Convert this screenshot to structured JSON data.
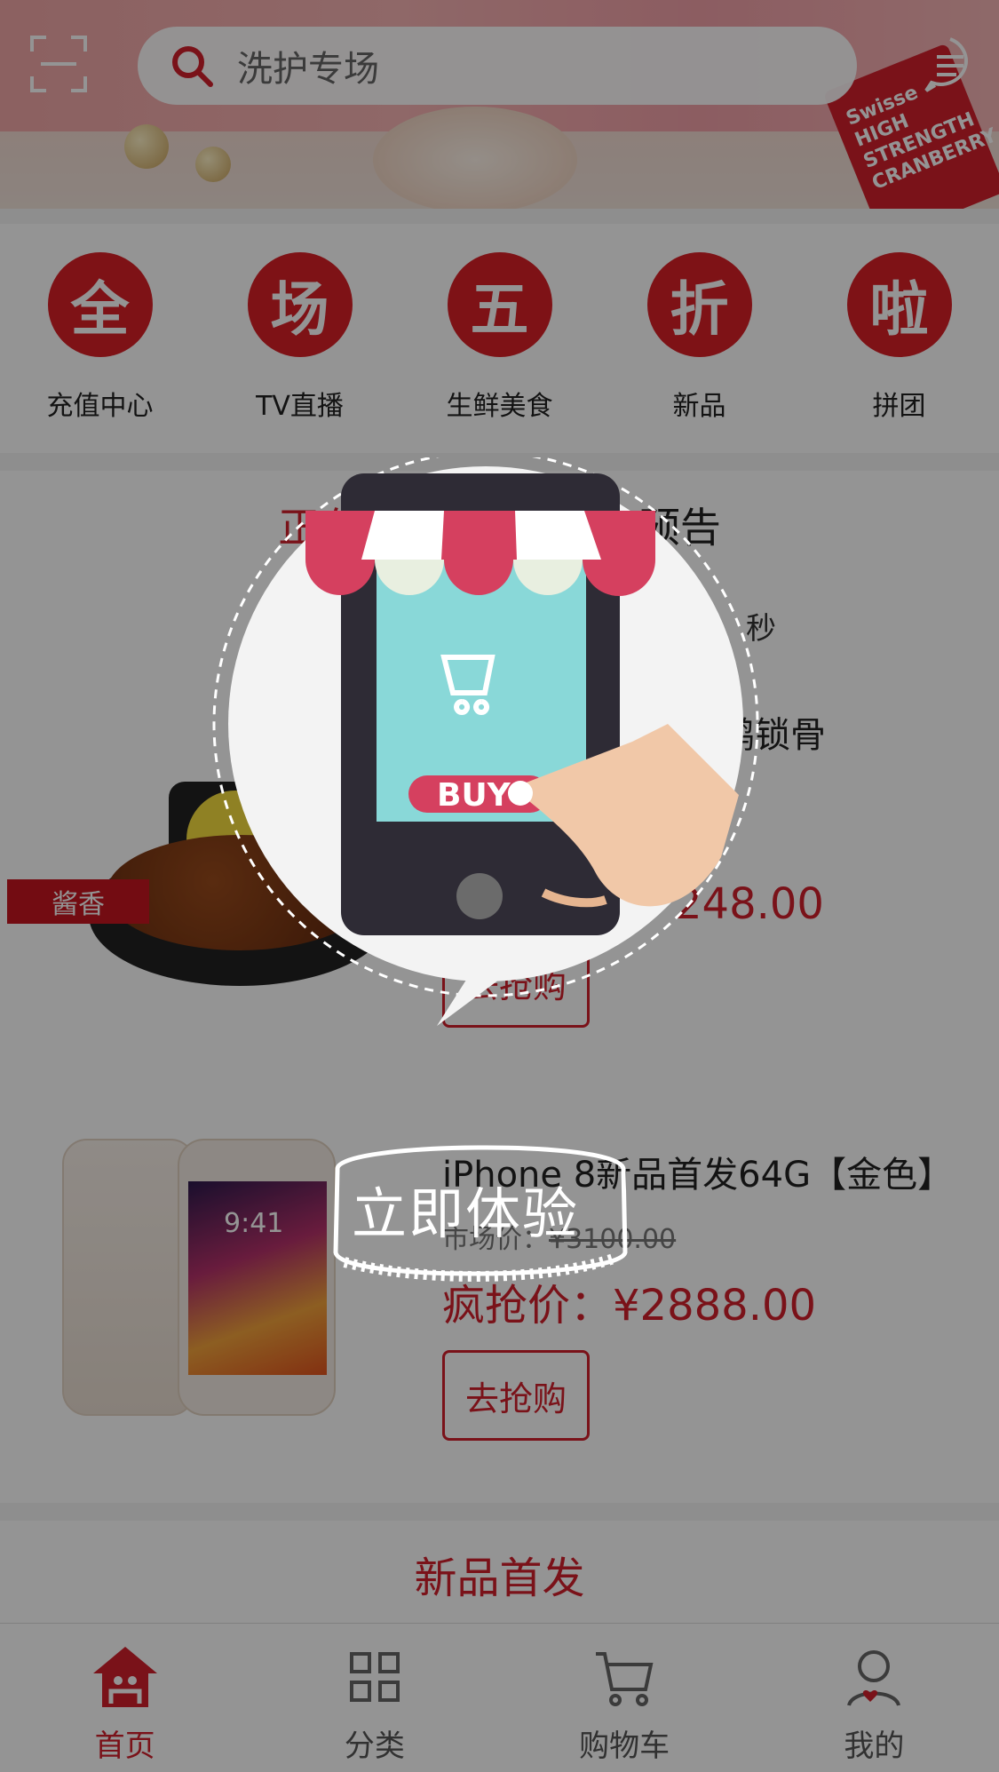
{
  "search": {
    "placeholder": "洗护专场"
  },
  "banner": {
    "bottle_text": "Swisse HIGH STRENGTH CRANBERRY"
  },
  "categories": [
    {
      "char": "全",
      "label": "充值中心"
    },
    {
      "char": "场",
      "label": "TV直播"
    },
    {
      "char": "五",
      "label": "生鲜美食"
    },
    {
      "char": "折",
      "label": "新品"
    },
    {
      "char": "啦",
      "label": "拼团"
    }
  ],
  "flash": {
    "tab_active": "正在",
    "tab_other": "预告",
    "seconds_label": "秒",
    "products": [
      {
        "tag": "酱香",
        "title": "味鸭锁骨",
        "price": "248.00",
        "button": "去抢购"
      },
      {
        "title": "iPhone 8新品首发64G【金色】",
        "market_label": "市场价：",
        "market_price": "¥3100.00",
        "price_label": "疯抢价：",
        "price": "¥2888.00",
        "button": "去抢购",
        "screen_time": "9:41"
      }
    ]
  },
  "new_section": {
    "title": "新品首发"
  },
  "tabbar": [
    {
      "label": "首页",
      "active": true
    },
    {
      "label": "分类"
    },
    {
      "label": "购物车"
    },
    {
      "label": "我的"
    }
  ],
  "splash": {
    "buy_label": "BUY",
    "cta": "立即体验"
  },
  "colors": {
    "brand_red": "#d21f2c",
    "overlay": "rgba(0,0,0,0.42)"
  }
}
